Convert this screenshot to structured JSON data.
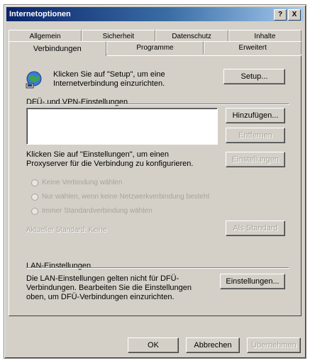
{
  "window": {
    "title": "Internetoptionen",
    "title_buttons": [
      "?",
      "X"
    ]
  },
  "tabs": {
    "row1": [
      "Allgemein",
      "Sicherheit",
      "Datenschutz",
      "Inhalte"
    ],
    "row2": [
      "Verbindungen",
      "Programme",
      "Erweitert"
    ],
    "active": "Verbindungen"
  },
  "setup": {
    "description": "Klicken Sie auf \"Setup\", um eine Internetverbindung einzurichten.",
    "button_label": "Setup..."
  },
  "dfu": {
    "group_label": "DFÜ- und VPN-Einstellungen",
    "items": [],
    "add_button": "Hinzufügen...",
    "remove_button": "Entfernen",
    "settings_button": "Einstellungen",
    "proxy_hint": "Klicken Sie auf \"Einstellungen\", um einen Proxyserver für die Verbindung zu konfigurieren.",
    "radio_options": [
      "Keine Verbindung wählen",
      "Nur wählen, wenn keine Netzwerkverbindung besteht",
      "Immer Standardverbindung wählen"
    ],
    "current_default_label": "Aktueller Standard:",
    "current_default_value": "Keine",
    "set_default_button": "Als Standard"
  },
  "lan": {
    "group_label": "LAN-Einstellungen",
    "description": "Die LAN-Einstellungen gelten nicht für DFÜ-Verbindungen. Bearbeiten Sie die Einstellungen oben, um DFÜ-Verbindungen einzurichten.",
    "button_label": "Einstellungen..."
  },
  "footer": {
    "ok": "OK",
    "cancel": "Abbrechen",
    "apply": "Übernehmen"
  },
  "colors": {
    "face": "#d4d0c8",
    "title_start": "#0a246a",
    "title_end": "#a6caf0",
    "disabled_text": "#a8a49c"
  }
}
